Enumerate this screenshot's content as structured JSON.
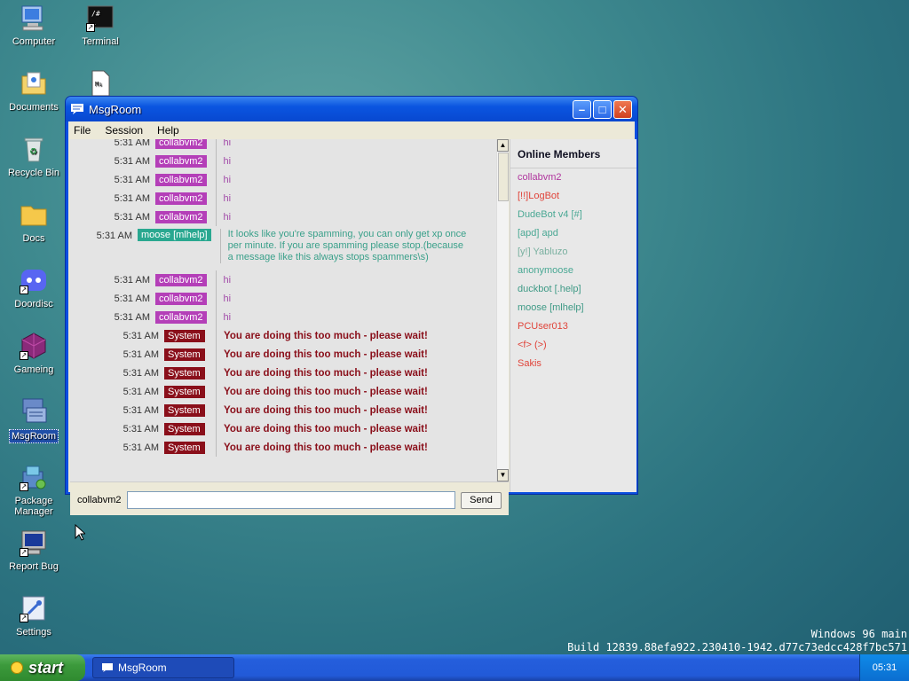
{
  "desktop": {
    "icons": [
      {
        "label": "Computer"
      },
      {
        "label": "Terminal"
      },
      {
        "label": "Documents"
      },
      {
        "label": "Recycle Bin"
      },
      {
        "label": "Docs"
      },
      {
        "label": "Doordisc"
      },
      {
        "label": "Gameing"
      },
      {
        "label": "MsgRoom"
      },
      {
        "label": "Package Manager"
      },
      {
        "label": "Report Bug"
      },
      {
        "label": "Settings"
      }
    ],
    "build": {
      "line1": "Windows 96 main",
      "line2": "Build 12839.88efa922.230410-1942.d77c73edcc428f7bc571"
    }
  },
  "window": {
    "title": "MsgRoom",
    "menu": {
      "file": "File",
      "session": "Session",
      "help": "Help"
    },
    "messages": [
      {
        "time": "5:31 AM",
        "user": "collabvm2",
        "text": "hi"
      },
      {
        "time": "5:31 AM",
        "user": "collabvm2",
        "text": "hi"
      },
      {
        "time": "5:31 AM",
        "user": "collabvm2",
        "text": "hi"
      },
      {
        "time": "5:31 AM",
        "user": "collabvm2",
        "text": "hi"
      },
      {
        "time": "5:31 AM",
        "user": "collabvm2",
        "text": "hi"
      },
      {
        "time": "5:31 AM",
        "user": "moose [mlhelp]",
        "text": "It looks like you're spamming, you can only get xp once per minute. If you are spamming please stop.(because a message like this always stops spammers\\s)"
      },
      {
        "time": "5:31 AM",
        "user": "collabvm2",
        "text": "hi"
      },
      {
        "time": "5:31 AM",
        "user": "collabvm2",
        "text": "hi"
      },
      {
        "time": "5:31 AM",
        "user": "collabvm2",
        "text": "hi"
      },
      {
        "time": "5:31 AM",
        "user": "System",
        "text": "You are doing this too much - please wait!"
      },
      {
        "time": "5:31 AM",
        "user": "System",
        "text": "You are doing this too much - please wait!"
      },
      {
        "time": "5:31 AM",
        "user": "System",
        "text": "You are doing this too much - please wait!"
      },
      {
        "time": "5:31 AM",
        "user": "System",
        "text": "You are doing this too much - please wait!"
      },
      {
        "time": "5:31 AM",
        "user": "System",
        "text": "You are doing this too much - please wait!"
      },
      {
        "time": "5:31 AM",
        "user": "System",
        "text": "You are doing this too much - please wait!"
      },
      {
        "time": "5:31 AM",
        "user": "System",
        "text": "You are doing this too much - please wait!"
      }
    ],
    "members_title": "Online Members",
    "members": [
      {
        "name": "collabvm2",
        "color": "#b0369e"
      },
      {
        "name": "[!!]LogBot",
        "color": "#e0443a"
      },
      {
        "name": "DudeBot v4 [#]",
        "color": "#4aa894"
      },
      {
        "name": "[apd] apd",
        "color": "#4aa894"
      },
      {
        "name": "[y!] Yabluzo",
        "color": "#7ab0a0"
      },
      {
        "name": "anonymoose",
        "color": "#4aa894"
      },
      {
        "name": "duckbot [.help]",
        "color": "#3f9a86"
      },
      {
        "name": "moose [mlhelp]",
        "color": "#3f9a86"
      },
      {
        "name": "PCUser013",
        "color": "#e0443a"
      },
      {
        "name": "<f> (>)",
        "color": "#e0443a"
      },
      {
        "name": "Sakis",
        "color": "#e0443a"
      }
    ],
    "input": {
      "nick": "collabvm2",
      "value": "",
      "send": "Send"
    }
  },
  "colors": {
    "collabvm2": "#b43fb8",
    "moose": "#2aa890",
    "system": "#8a0f1a",
    "hi_text": "#a24aa8",
    "moose_text": "#3aa08a",
    "system_text": "#8a0f1a"
  },
  "taskbar": {
    "start": "start",
    "task": "MsgRoom",
    "clock": "05:31"
  }
}
